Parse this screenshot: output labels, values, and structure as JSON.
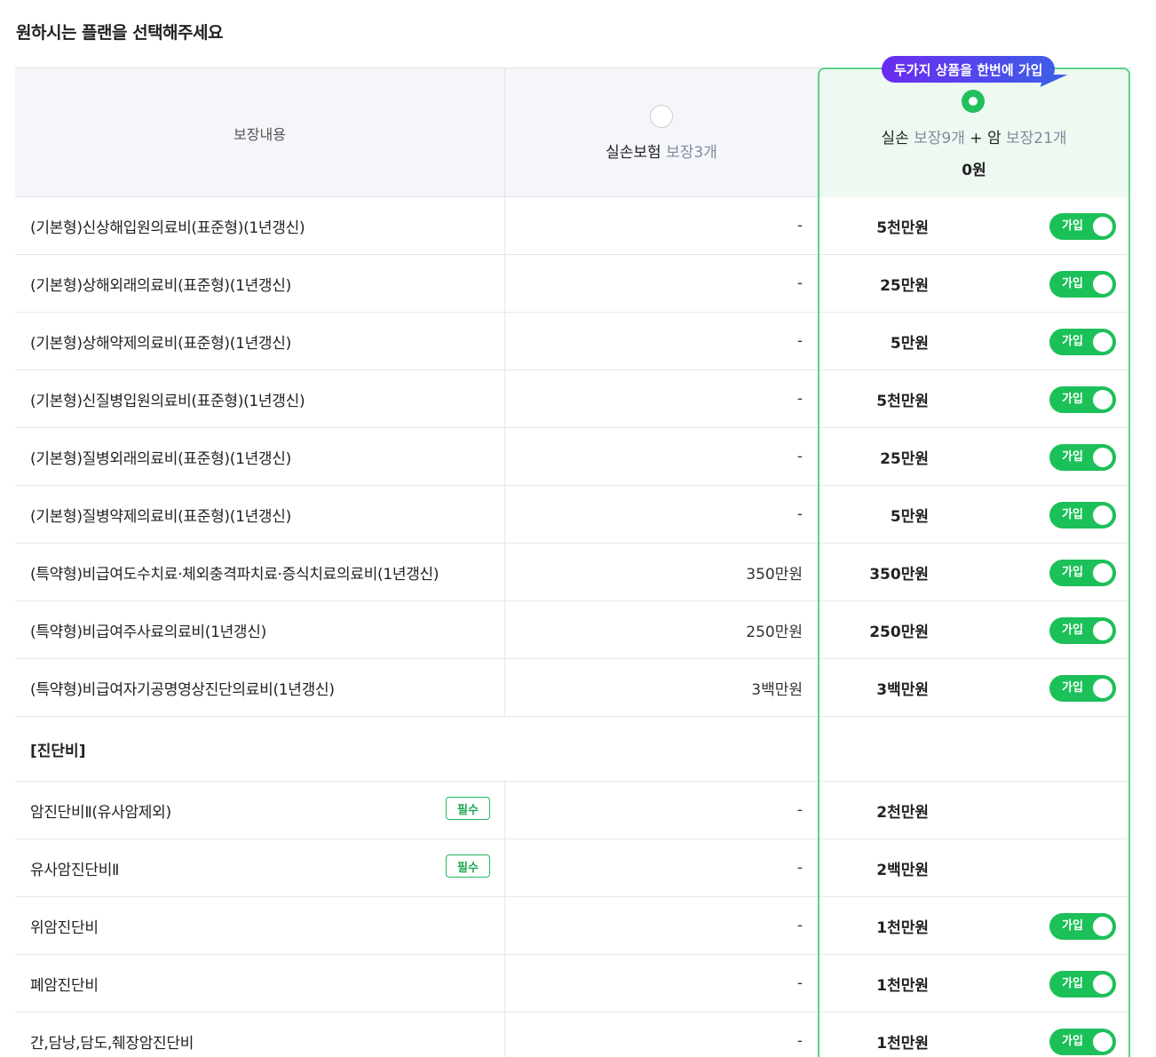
{
  "page_title": "원하시는 플랜을 선택해주세요",
  "header": {
    "coverage_label": "보장내용",
    "plan1": {
      "name": "실손보험",
      "count": "보장3개",
      "selected": false
    },
    "plan2": {
      "ribbon": "두가지 상품을 한번에 가입",
      "name_a": "실손",
      "count_a": "보장9개",
      "plus": "+",
      "name_b": "암",
      "count_b": "보장21개",
      "price": "0원",
      "selected": true
    }
  },
  "toggle_label": "가입",
  "required_label": "필수",
  "rows_group1": [
    {
      "name": "(기본형)신상해입원의료비(표준형)(1년갱신)",
      "plan1": "-",
      "plan2": "5천만원"
    },
    {
      "name": "(기본형)상해외래의료비(표준형)(1년갱신)",
      "plan1": "-",
      "plan2": "25만원"
    },
    {
      "name": "(기본형)상해약제의료비(표준형)(1년갱신)",
      "plan1": "-",
      "plan2": "5만원"
    },
    {
      "name": "(기본형)신질병입원의료비(표준형)(1년갱신)",
      "plan1": "-",
      "plan2": "5천만원"
    },
    {
      "name": "(기본형)질병외래의료비(표준형)(1년갱신)",
      "plan1": "-",
      "plan2": "25만원"
    },
    {
      "name": "(기본형)질병약제의료비(표준형)(1년갱신)",
      "plan1": "-",
      "plan2": "5만원"
    },
    {
      "name": "(특약형)비급여도수치료·체외충격파치료·증식치료의료비(1년갱신)",
      "plan1": "350만원",
      "plan2": "350만원"
    },
    {
      "name": "(특약형)비급여주사료의료비(1년갱신)",
      "plan1": "250만원",
      "plan2": "250만원"
    },
    {
      "name": "(특약형)비급여자기공명영상진단의료비(1년갱신)",
      "plan1": "3백만원",
      "plan2": "3백만원"
    }
  ],
  "section_title": "[진단비]",
  "rows_group2": [
    {
      "name": "암진단비Ⅱ(유사암제외)",
      "plan1": "-",
      "plan2": "2천만원",
      "required": true
    },
    {
      "name": "유사암진단비Ⅱ",
      "plan1": "-",
      "plan2": "2백만원",
      "required": true
    },
    {
      "name": "위암진단비",
      "plan1": "-",
      "plan2": "1천만원",
      "required": false
    },
    {
      "name": "폐암진단비",
      "plan1": "-",
      "plan2": "1천만원",
      "required": false
    },
    {
      "name": "간,담낭,담도,췌장암진단비",
      "plan1": "-",
      "plan2": "1천만원",
      "required": false
    }
  ],
  "colors": {
    "accent_green": "#1cc058",
    "frame_green": "#5ed28b",
    "ribbon_start": "#6a2cf0",
    "ribbon_end": "#3f5ce8",
    "header_bg": "#f4f6f9"
  }
}
